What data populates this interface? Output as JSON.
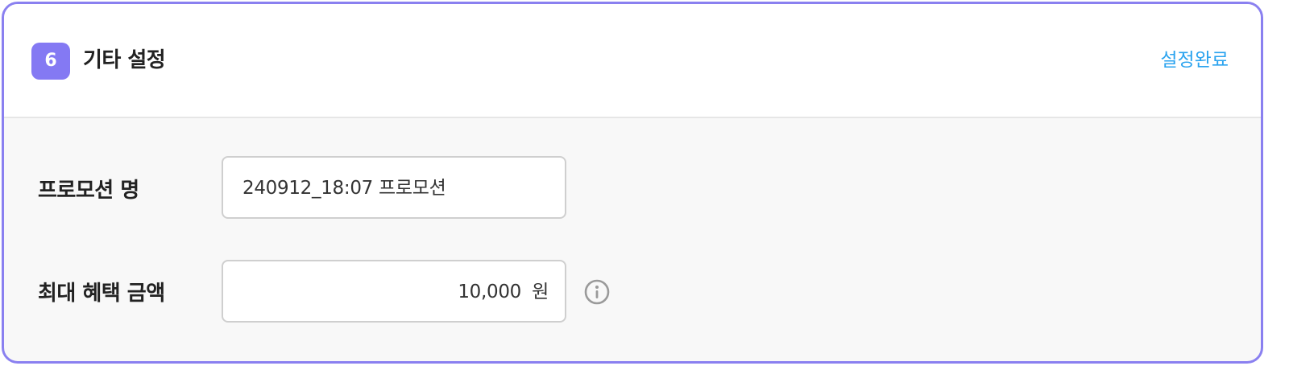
{
  "section": {
    "step_number": "6",
    "title": "기타 설정",
    "complete_label": "설정완료"
  },
  "promotion_name": {
    "label": "프로모션 명",
    "value": "240912_18:07 프로모션"
  },
  "max_benefit": {
    "label": "최대 혜택 금액",
    "value": "10,000",
    "unit": "원",
    "info_icon": "info-circle-icon"
  },
  "colors": {
    "accent": "#8479f3",
    "card_border": "#8a80f0",
    "link": "#2aa3ef",
    "body_bg": "#f8f8f8",
    "text": "#222222"
  }
}
